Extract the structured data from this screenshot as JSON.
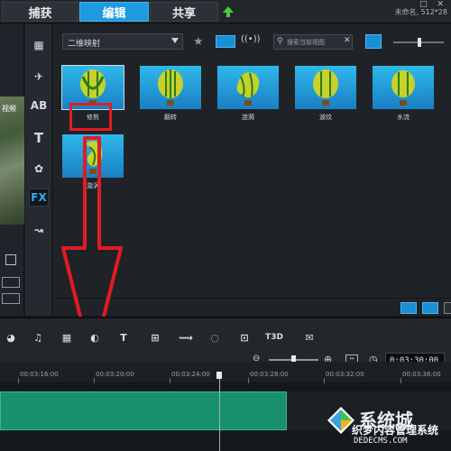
{
  "tabs": [
    {
      "label": "捕获",
      "active": false
    },
    {
      "label": "编辑",
      "active": true
    },
    {
      "label": "共享",
      "active": false
    }
  ],
  "project_info": "未命名, 512*28",
  "preview": {
    "overlay_text": "视频"
  },
  "library": {
    "folder": "二维映射",
    "search_placeholder": "搜索当前视图",
    "thumbnails": [
      {
        "label": "修剪"
      },
      {
        "label": "翻转"
      },
      {
        "label": "涟漪"
      },
      {
        "label": "波纹"
      },
      {
        "label": "水流"
      },
      {
        "label": "漩涡"
      }
    ]
  },
  "category_icons": [
    "media-icon",
    "instant-project-icon",
    "transition-icon",
    "title-icon",
    "graphics-icon",
    "filter-fx-icon",
    "path-icon"
  ],
  "ruler_labels": [
    "00:03:16:00",
    "00:03:20:00",
    "00:03:24:00",
    "00:03:28:00",
    "00:03:32:00",
    "00:03:36:00"
  ],
  "timecode": "0:03:30:00",
  "watermark": {
    "brand": "系统城",
    "subtitle": "织梦内容管理系统",
    "url": "DEDECMS.COM"
  },
  "colors": {
    "accent": "#1d9be0",
    "highlight_box": "#e21b23",
    "clip": "#19906d"
  }
}
